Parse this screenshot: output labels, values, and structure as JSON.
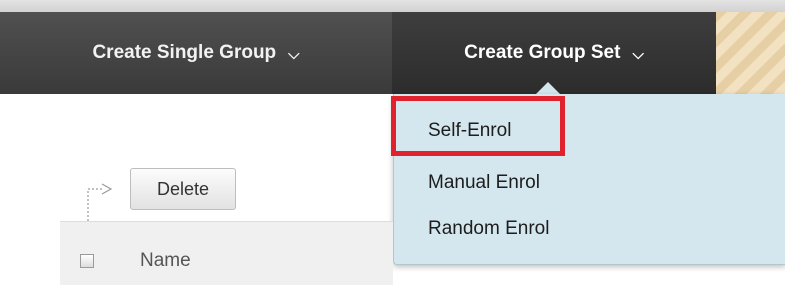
{
  "action_bar": {
    "create_single_group": {
      "label": "Create Single Group",
      "chevron_icon": "chevron-down-icon"
    },
    "create_group_set": {
      "label": "Create Group Set",
      "chevron_icon": "chevron-down-icon"
    }
  },
  "group_set_menu": {
    "items": [
      {
        "label": "Self-Enrol",
        "highlighted": true
      },
      {
        "label": "Manual Enrol"
      },
      {
        "label": "Random Enrol"
      }
    ],
    "highlight_color": "#e0212e"
  },
  "toolbar": {
    "delete_label": "Delete"
  },
  "table": {
    "header": {
      "checked": false,
      "name_label": "Name"
    }
  },
  "colors": {
    "action_bar": "#3b3b3b",
    "menu_background": "#d4e7ee",
    "header_background": "#f0f0f0"
  }
}
